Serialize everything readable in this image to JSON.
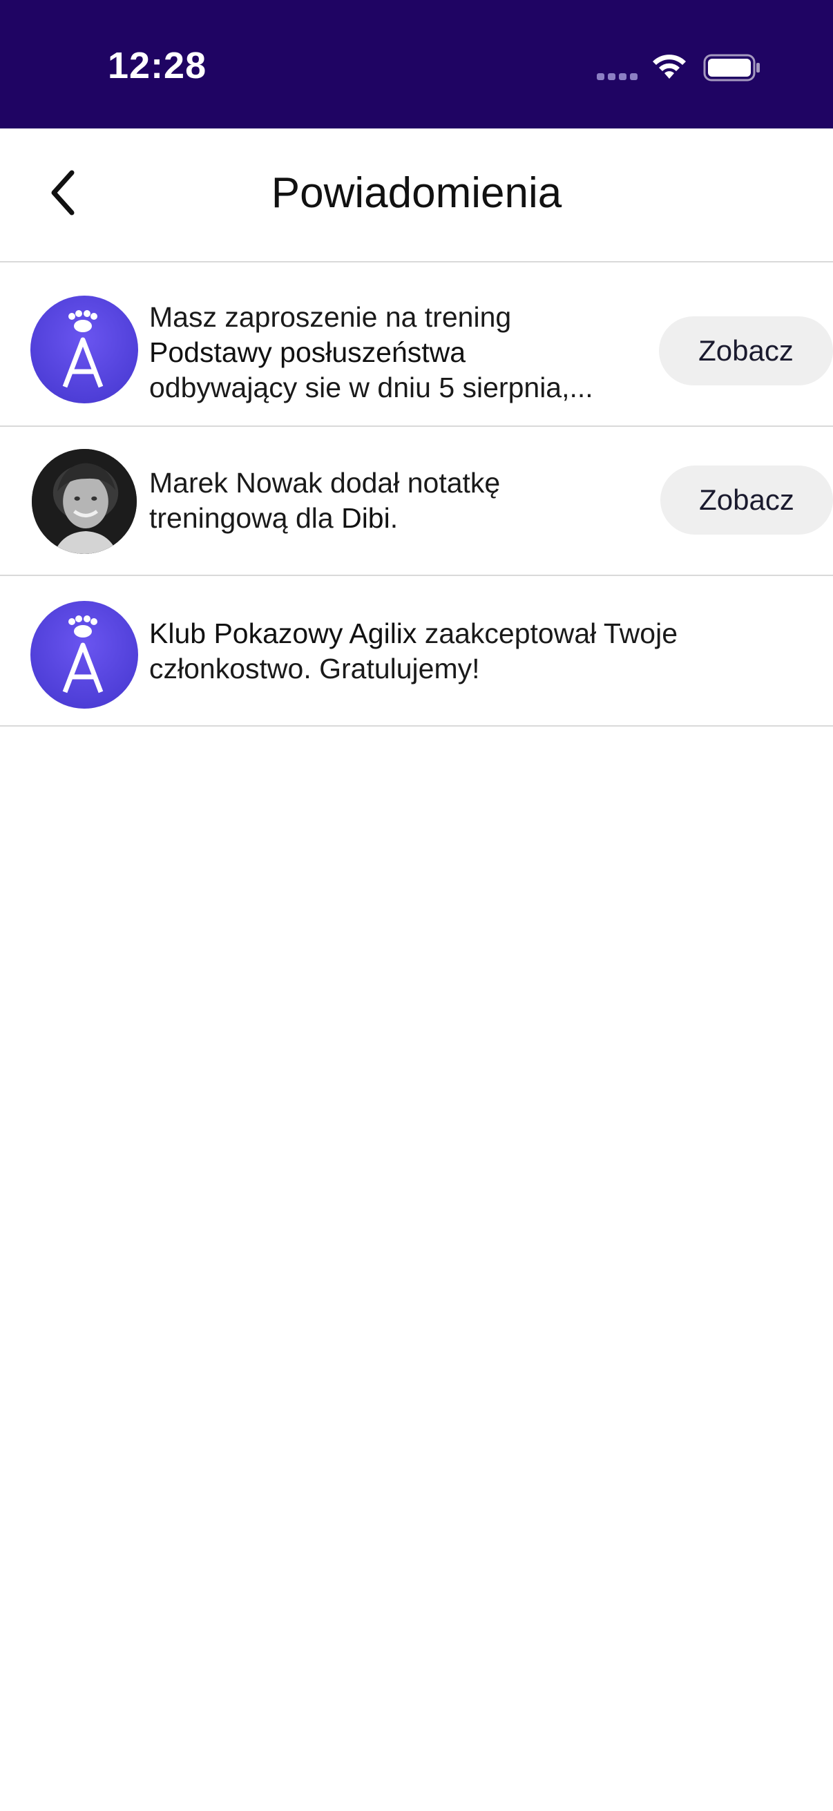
{
  "status_bar": {
    "time": "12:28",
    "icons": [
      "signal-icon",
      "wifi-icon",
      "battery-icon"
    ]
  },
  "nav": {
    "back_icon": "chevron-left-icon",
    "title": "Powiadomienia"
  },
  "notifications": [
    {
      "avatar": "brand-logo",
      "text_line1": "Masz zaproszenie na trening",
      "text_line2_bold": "Podstawy posłuszeństwa",
      "text_line3": "odbywający sie w dniu 5 sierpnia,...",
      "button_label": "Zobacz"
    },
    {
      "avatar": "user-photo",
      "text_line1": "Marek Nowak dodał notatkę",
      "text_line2_pre": "treningową dla",
      "text_line2_bold": "Dibi",
      "text_line2_post": ".",
      "button_label": "Zobacz"
    },
    {
      "avatar": "brand-logo",
      "text_bold": "Klub Pokazowy Agilix",
      "text_rest": " zaakceptował Twoje",
      "text_line2": "członkostwo. Gratulujemy!"
    }
  ],
  "colors": {
    "status_bar_bg": "#1f0463",
    "brand_avatar": "#5a47e6",
    "button_bg": "#efefef",
    "divider": "#d9d9d9"
  }
}
